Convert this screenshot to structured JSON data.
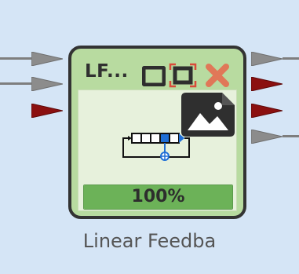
{
  "block": {
    "title": "LF...",
    "caption": "Linear Feedba",
    "progress_label": "100%",
    "progress_value": 1.0
  },
  "ports": {
    "inputs": [
      {
        "name": "input-port-1",
        "color": "#8c8c8c"
      },
      {
        "name": "input-port-2",
        "color": "#8c8c8c"
      },
      {
        "name": "input-port-3",
        "color": "#8b1010"
      }
    ],
    "outputs": [
      {
        "name": "output-port-1",
        "color": "#8c8c8c"
      },
      {
        "name": "output-port-2",
        "color": "#8b1010"
      },
      {
        "name": "output-port-3",
        "color": "#8b1010"
      },
      {
        "name": "output-port-4",
        "color": "#8c8c8c"
      }
    ]
  },
  "icons": [
    "restore-icon",
    "fit-icon",
    "close-icon",
    "image-icon",
    "lfsr-icon"
  ],
  "colors": {
    "canvas": "#d5e5f6",
    "block_border": "#333333",
    "block_fill": "#b8dba0",
    "close": "#e07858",
    "fit_accent": "#d94a3a"
  }
}
